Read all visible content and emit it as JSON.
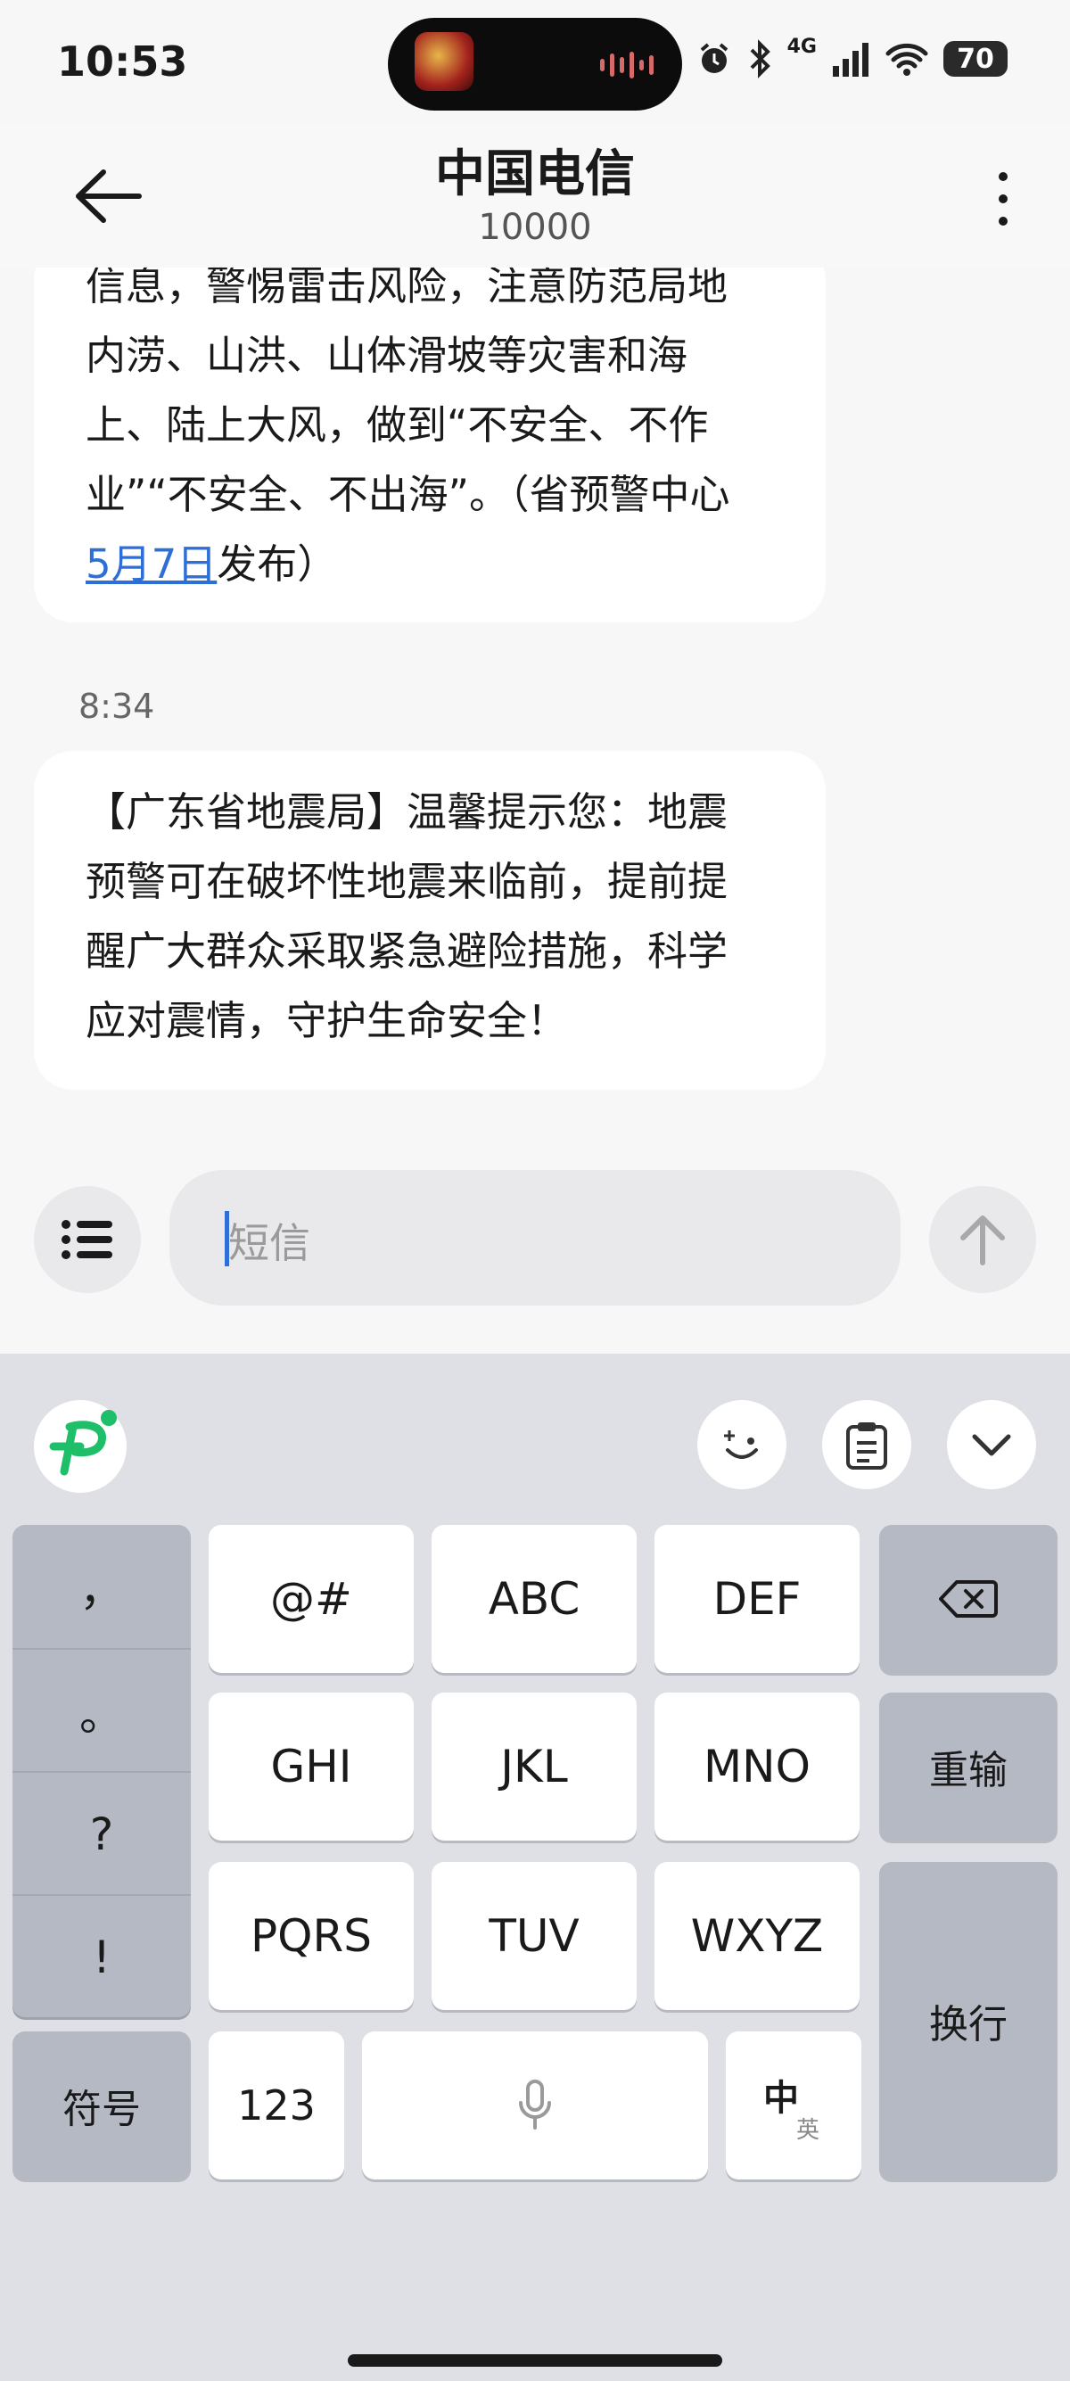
{
  "status_bar": {
    "time": "10:53",
    "network": "4G",
    "battery": "70"
  },
  "header": {
    "title": "中国电信",
    "subtitle": "10000"
  },
  "messages": [
    {
      "lines": [
        "信息，警惕雷击风险，注意防范局地",
        "内涝、山洪、山体滑坡等灾害和海",
        "上、陆上大风，做到“不安全、不作",
        "业”“不安全、不出海”。（省预警中心"
      ],
      "link": "5月7日",
      "after_link": "发布）"
    },
    {
      "time": "8:34",
      "lines": [
        "【广东省地震局】温馨提示您：地震",
        "预警可在破坏性地震来临前，提前提",
        "醒广大群众采取紧急避险措施，科学",
        "应对震情，守护生命安全！"
      ]
    }
  ],
  "composer": {
    "placeholder": "短信"
  },
  "keyboard": {
    "punctuation": [
      "，",
      "。",
      "?",
      "!"
    ],
    "symbols_label": "符号",
    "rows": [
      [
        "@#",
        "ABC",
        "DEF"
      ],
      [
        "GHI",
        "JKL",
        "MNO"
      ],
      [
        "PQRS",
        "TUV",
        "WXYZ"
      ]
    ],
    "reinput_label": "重输",
    "newline_label": "换行",
    "numbers_label": "123",
    "lang_primary": "中",
    "lang_secondary": "英"
  },
  "colors": {
    "link": "#2d6fd6",
    "keyboard_bg": "#dfe0e5",
    "logo_green": "#1fbf6a"
  },
  "icons": [
    "back-arrow-icon",
    "more-vertical-icon",
    "list-icon",
    "send-arrow-icon",
    "logo-icon",
    "emoji-icon",
    "clipboard-icon",
    "chevron-down-icon",
    "backspace-icon",
    "microphone-icon",
    "alarm-icon",
    "bluetooth-icon",
    "signal-icon",
    "wifi-icon"
  ]
}
